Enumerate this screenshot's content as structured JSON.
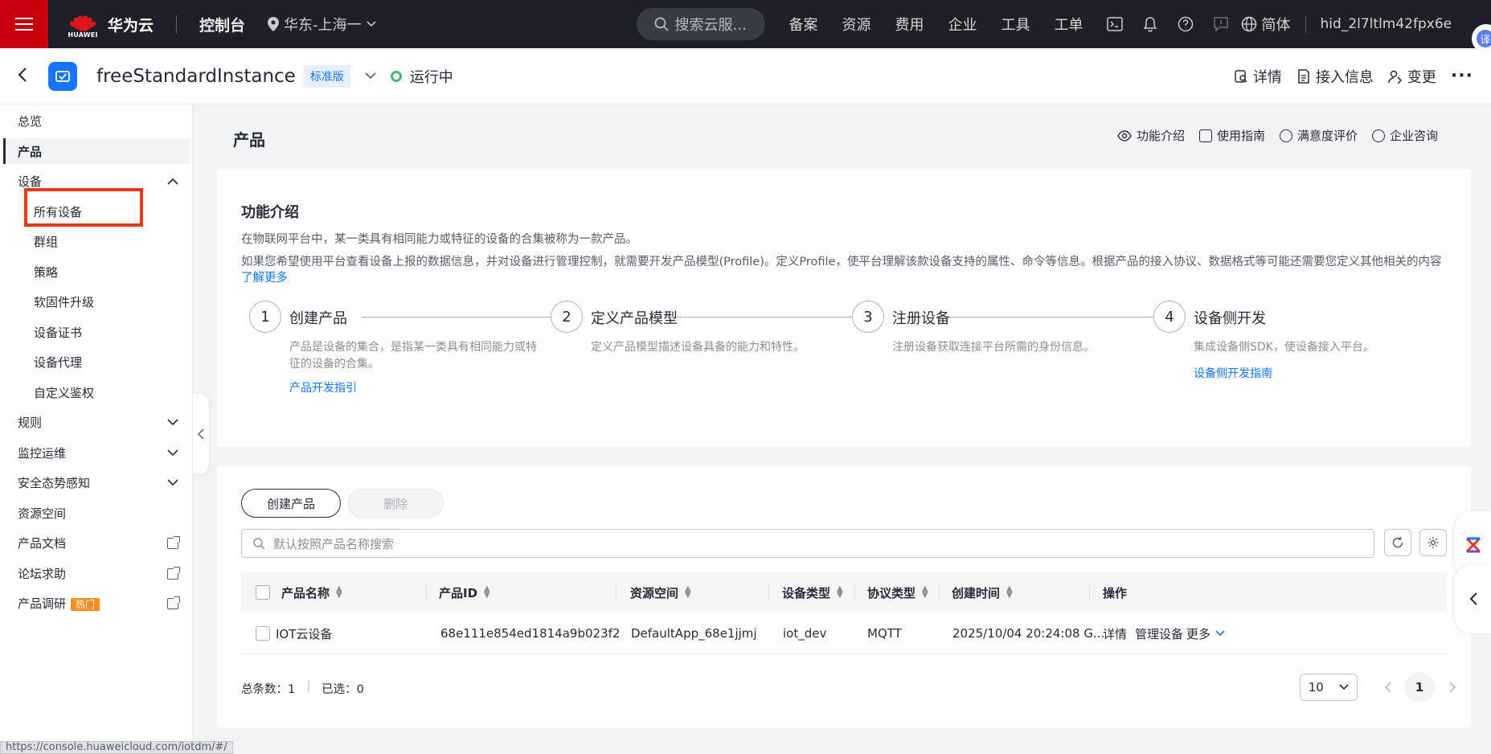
{
  "topbar": {
    "brand_caption": "HUAWEI",
    "brand": "华为云",
    "console": "控制台",
    "region": "华东-上海一",
    "search_placeholder": "搜索云服...",
    "nav": [
      "备案",
      "资源",
      "费用",
      "企业",
      "工具",
      "工单"
    ],
    "lang": "简体",
    "username": "hid_2l7ltlm42fpx6e",
    "translate_badge": "译",
    "accent": "#c7000b"
  },
  "instance": {
    "name": "freeStandardInstance",
    "edition": "标准版",
    "status": "运行中",
    "status_color": "#50b370",
    "actions": [
      "详情",
      "接入信息",
      "变更"
    ]
  },
  "sidebar": {
    "items": [
      {
        "label": "总览"
      },
      {
        "label": "产品"
      },
      {
        "label": "设备"
      },
      {
        "label": "所有设备"
      },
      {
        "label": "群组"
      },
      {
        "label": "策略"
      },
      {
        "label": "软固件升级"
      },
      {
        "label": "设备证书"
      },
      {
        "label": "设备代理"
      },
      {
        "label": "自定义鉴权"
      },
      {
        "label": "规则"
      },
      {
        "label": "监控运维"
      },
      {
        "label": "安全态势感知"
      },
      {
        "label": "资源空间"
      },
      {
        "label": "产品文档"
      },
      {
        "label": "论坛求助"
      },
      {
        "label": "产品调研"
      }
    ],
    "hot_tag": "热门"
  },
  "page": {
    "title": "产品",
    "links": [
      "功能介绍",
      "使用指南",
      "满意度评价",
      "企业咨询"
    ]
  },
  "intro": {
    "title": "功能介绍",
    "p1": "在物联网平台中，某一类具有相同能力或特征的设备的合集被称为一款产品。",
    "p2": "如果您希望使用平台查看设备上报的数据信息，并对设备进行管理控制，就需要开发产品模型(Profile)。定义Profile，使平台理解该款设备支持的属性、命令等信息。根据产品的接入协议、数据格式等可能还需要您定义其他相关的内容",
    "learn_more": "了解更多",
    "steps": [
      {
        "num": "1",
        "title": "创建产品",
        "desc": "产品是设备的集合，是指某一类具有相同能力或特征的设备的合集。",
        "link": "产品开发指引"
      },
      {
        "num": "2",
        "title": "定义产品模型",
        "desc": "定义产品模型描述设备具备的能力和特性。",
        "link": ""
      },
      {
        "num": "3",
        "title": "注册设备",
        "desc": "注册设备获取连接平台所需的身份信息。",
        "link": ""
      },
      {
        "num": "4",
        "title": "设备侧开发",
        "desc": "集成设备侧SDK，使设备接入平台。",
        "link": "设备侧开发指南"
      }
    ]
  },
  "table": {
    "create_label": "创建产品",
    "delete_label": "删除",
    "search_placeholder": "默认按照产品名称搜索",
    "columns": [
      "产品名称",
      "产品ID",
      "资源空间",
      "设备类型",
      "协议类型",
      "创建时间",
      "操作"
    ],
    "rows": [
      {
        "name": "IOT云设备",
        "id": "68e111e854ed1814a9b023f2",
        "space": "DefaultApp_68e1jjmj",
        "device_type": "iot_dev",
        "protocol": "MQTT",
        "created": "2025/10/04 20:24:08 G...",
        "ops": [
          "详情",
          "管理设备",
          "更多"
        ]
      }
    ],
    "total_label": "总条数：",
    "total": "1",
    "selected_label": "已选：",
    "selected": "0",
    "page_size": "10",
    "current_page": "1"
  },
  "status_url": "https://console.huaweicloud.com/iotdm/#/"
}
